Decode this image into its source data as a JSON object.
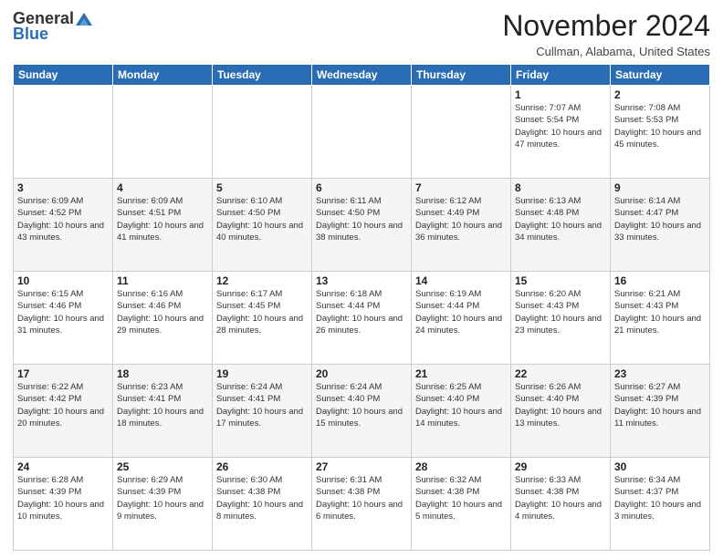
{
  "logo": {
    "general": "General",
    "blue": "Blue"
  },
  "header": {
    "month": "November 2024",
    "location": "Cullman, Alabama, United States"
  },
  "days_of_week": [
    "Sunday",
    "Monday",
    "Tuesday",
    "Wednesday",
    "Thursday",
    "Friday",
    "Saturday"
  ],
  "weeks": [
    [
      {
        "day": "",
        "info": ""
      },
      {
        "day": "",
        "info": ""
      },
      {
        "day": "",
        "info": ""
      },
      {
        "day": "",
        "info": ""
      },
      {
        "day": "",
        "info": ""
      },
      {
        "day": "1",
        "info": "Sunrise: 7:07 AM\nSunset: 5:54 PM\nDaylight: 10 hours and 47 minutes."
      },
      {
        "day": "2",
        "info": "Sunrise: 7:08 AM\nSunset: 5:53 PM\nDaylight: 10 hours and 45 minutes."
      }
    ],
    [
      {
        "day": "3",
        "info": "Sunrise: 6:09 AM\nSunset: 4:52 PM\nDaylight: 10 hours and 43 minutes."
      },
      {
        "day": "4",
        "info": "Sunrise: 6:09 AM\nSunset: 4:51 PM\nDaylight: 10 hours and 41 minutes."
      },
      {
        "day": "5",
        "info": "Sunrise: 6:10 AM\nSunset: 4:50 PM\nDaylight: 10 hours and 40 minutes."
      },
      {
        "day": "6",
        "info": "Sunrise: 6:11 AM\nSunset: 4:50 PM\nDaylight: 10 hours and 38 minutes."
      },
      {
        "day": "7",
        "info": "Sunrise: 6:12 AM\nSunset: 4:49 PM\nDaylight: 10 hours and 36 minutes."
      },
      {
        "day": "8",
        "info": "Sunrise: 6:13 AM\nSunset: 4:48 PM\nDaylight: 10 hours and 34 minutes."
      },
      {
        "day": "9",
        "info": "Sunrise: 6:14 AM\nSunset: 4:47 PM\nDaylight: 10 hours and 33 minutes."
      }
    ],
    [
      {
        "day": "10",
        "info": "Sunrise: 6:15 AM\nSunset: 4:46 PM\nDaylight: 10 hours and 31 minutes."
      },
      {
        "day": "11",
        "info": "Sunrise: 6:16 AM\nSunset: 4:46 PM\nDaylight: 10 hours and 29 minutes."
      },
      {
        "day": "12",
        "info": "Sunrise: 6:17 AM\nSunset: 4:45 PM\nDaylight: 10 hours and 28 minutes."
      },
      {
        "day": "13",
        "info": "Sunrise: 6:18 AM\nSunset: 4:44 PM\nDaylight: 10 hours and 26 minutes."
      },
      {
        "day": "14",
        "info": "Sunrise: 6:19 AM\nSunset: 4:44 PM\nDaylight: 10 hours and 24 minutes."
      },
      {
        "day": "15",
        "info": "Sunrise: 6:20 AM\nSunset: 4:43 PM\nDaylight: 10 hours and 23 minutes."
      },
      {
        "day": "16",
        "info": "Sunrise: 6:21 AM\nSunset: 4:43 PM\nDaylight: 10 hours and 21 minutes."
      }
    ],
    [
      {
        "day": "17",
        "info": "Sunrise: 6:22 AM\nSunset: 4:42 PM\nDaylight: 10 hours and 20 minutes."
      },
      {
        "day": "18",
        "info": "Sunrise: 6:23 AM\nSunset: 4:41 PM\nDaylight: 10 hours and 18 minutes."
      },
      {
        "day": "19",
        "info": "Sunrise: 6:24 AM\nSunset: 4:41 PM\nDaylight: 10 hours and 17 minutes."
      },
      {
        "day": "20",
        "info": "Sunrise: 6:24 AM\nSunset: 4:40 PM\nDaylight: 10 hours and 15 minutes."
      },
      {
        "day": "21",
        "info": "Sunrise: 6:25 AM\nSunset: 4:40 PM\nDaylight: 10 hours and 14 minutes."
      },
      {
        "day": "22",
        "info": "Sunrise: 6:26 AM\nSunset: 4:40 PM\nDaylight: 10 hours and 13 minutes."
      },
      {
        "day": "23",
        "info": "Sunrise: 6:27 AM\nSunset: 4:39 PM\nDaylight: 10 hours and 11 minutes."
      }
    ],
    [
      {
        "day": "24",
        "info": "Sunrise: 6:28 AM\nSunset: 4:39 PM\nDaylight: 10 hours and 10 minutes."
      },
      {
        "day": "25",
        "info": "Sunrise: 6:29 AM\nSunset: 4:39 PM\nDaylight: 10 hours and 9 minutes."
      },
      {
        "day": "26",
        "info": "Sunrise: 6:30 AM\nSunset: 4:38 PM\nDaylight: 10 hours and 8 minutes."
      },
      {
        "day": "27",
        "info": "Sunrise: 6:31 AM\nSunset: 4:38 PM\nDaylight: 10 hours and 6 minutes."
      },
      {
        "day": "28",
        "info": "Sunrise: 6:32 AM\nSunset: 4:38 PM\nDaylight: 10 hours and 5 minutes."
      },
      {
        "day": "29",
        "info": "Sunrise: 6:33 AM\nSunset: 4:38 PM\nDaylight: 10 hours and 4 minutes."
      },
      {
        "day": "30",
        "info": "Sunrise: 6:34 AM\nSunset: 4:37 PM\nDaylight: 10 hours and 3 minutes."
      }
    ]
  ]
}
